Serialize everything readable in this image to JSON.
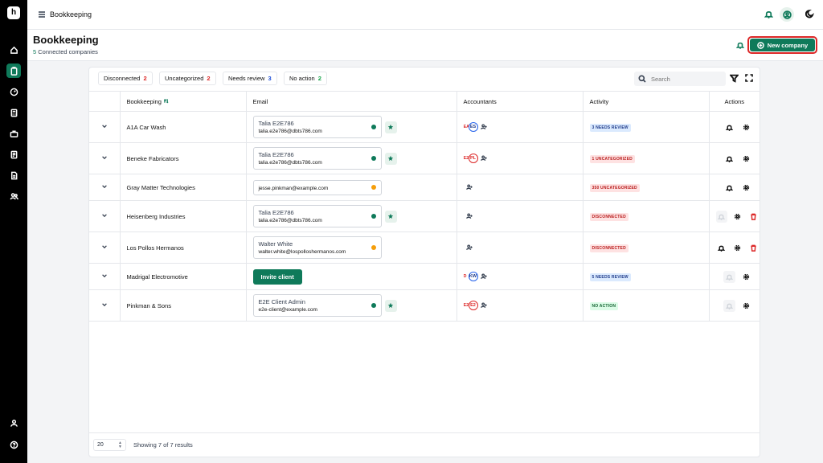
{
  "topbar": {
    "breadcrumb": "Bookkeeping"
  },
  "header": {
    "title": "Bookkeeping",
    "sub_count": "5",
    "sub_text": "Connected companies",
    "new_button": "New company"
  },
  "filters": [
    {
      "label": "Disconnected",
      "count": "2",
      "color": "#dc2626"
    },
    {
      "label": "Uncategorized",
      "count": "2",
      "color": "#dc2626"
    },
    {
      "label": "Needs review",
      "count": "3",
      "color": "#1d4ed8"
    },
    {
      "label": "No action",
      "count": "2",
      "color": "#16a34a"
    }
  ],
  "search": {
    "placeholder": "Search"
  },
  "table": {
    "headers": {
      "bookkeeping": "Bookkeeping",
      "email": "Email",
      "accountants": "Accountants",
      "activity": "Activity",
      "actions": "Actions"
    },
    "rows": [
      {
        "company": "A1A Car Wash",
        "email_name": "Talia E2E786",
        "email": "talia.e2e786@dbts786.com",
        "status_color": "#0f7a5a",
        "starred": true,
        "acc_a": "EA",
        "acc_b": "ES",
        "acc_b_red": false,
        "activity": "3 NEEDS REVIEW",
        "badge": "blue",
        "actions": "normal"
      },
      {
        "company": "Beneke Fabricators",
        "email_name": "Talia E2E786",
        "email": "talia.e2e786@dbts786.com",
        "status_color": "#0f7a5a",
        "starred": true,
        "acc_a": "E2",
        "acc_b": "PL",
        "acc_b_red": true,
        "activity": "1 UNCATEGORIZED",
        "badge": "red",
        "actions": "normal"
      },
      {
        "company": "Gray Matter Technologies",
        "email_name": "",
        "email": "jesse.pinkman@example.com",
        "status_color": "#f59e0b",
        "starred": false,
        "acc_a": "",
        "acc_b": "",
        "acc_b_red": false,
        "activity": "350 UNCATEGORIZED",
        "badge": "red",
        "actions": "normal"
      },
      {
        "company": "Heisenberg Industries",
        "email_name": "Talia E2E786",
        "email": "talia.e2e786@dbts786.com",
        "status_color": "#0f7a5a",
        "starred": true,
        "acc_a": "",
        "acc_b": "",
        "acc_b_red": false,
        "activity": "DISCONNECTED",
        "badge": "red",
        "actions": "disabled-delete"
      },
      {
        "company": "Los Pollos Hermanos",
        "email_name": "Walter White",
        "email": "walter.white@lospolloshermanos.com",
        "status_color": "#f59e0b",
        "starred": false,
        "acc_a": "",
        "acc_b": "",
        "acc_b_red": false,
        "activity": "DISCONNECTED",
        "badge": "red",
        "actions": "delete"
      },
      {
        "company": "Madrigal Electromotive",
        "invite": "Invite client",
        "acc_a": "D",
        "acc_b": "KW",
        "acc_b_red": false,
        "activity": "5 NEEDS REVIEW",
        "badge": "blue",
        "actions": "disabled"
      },
      {
        "company": "Pinkman & Sons",
        "email_name": "E2E Client Admin",
        "email": "e2e-client@example.com",
        "status_color": "#0f7a5a",
        "starred": true,
        "acc_a": "E2",
        "acc_b": "E2",
        "acc_b_red": true,
        "activity": "NO ACTION",
        "badge": "green",
        "actions": "disabled"
      }
    ]
  },
  "footer": {
    "page_size": "20",
    "showing": "Showing 7 of 7 results"
  }
}
